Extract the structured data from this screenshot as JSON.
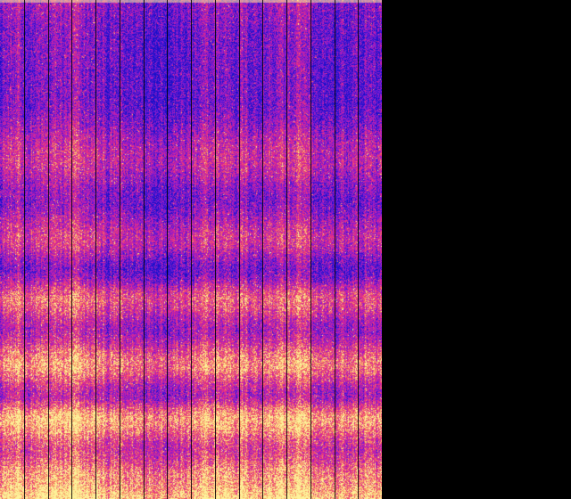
{
  "colormap": {
    "name": "plasma-like",
    "stops": [
      "#1a10c8",
      "#5a18d8",
      "#9a1ec8",
      "#d21fa0",
      "#ef3f70",
      "#f8a060",
      "#fdf29a"
    ]
  },
  "background_color": "#000000",
  "spectrogram": {
    "column_count": 16,
    "band_profile": [
      {
        "pos": 0.0,
        "level": 0.3
      },
      {
        "pos": 0.08,
        "level": 0.22
      },
      {
        "pos": 0.2,
        "level": 0.2
      },
      {
        "pos": 0.32,
        "level": 0.48
      },
      {
        "pos": 0.4,
        "level": 0.25
      },
      {
        "pos": 0.48,
        "level": 0.52
      },
      {
        "pos": 0.54,
        "level": 0.22
      },
      {
        "pos": 0.6,
        "level": 0.66
      },
      {
        "pos": 0.66,
        "level": 0.38
      },
      {
        "pos": 0.73,
        "level": 0.78
      },
      {
        "pos": 0.79,
        "level": 0.4
      },
      {
        "pos": 0.84,
        "level": 0.88
      },
      {
        "pos": 0.9,
        "level": 0.55
      },
      {
        "pos": 0.96,
        "level": 0.82
      },
      {
        "pos": 1.0,
        "level": 0.98
      }
    ]
  }
}
